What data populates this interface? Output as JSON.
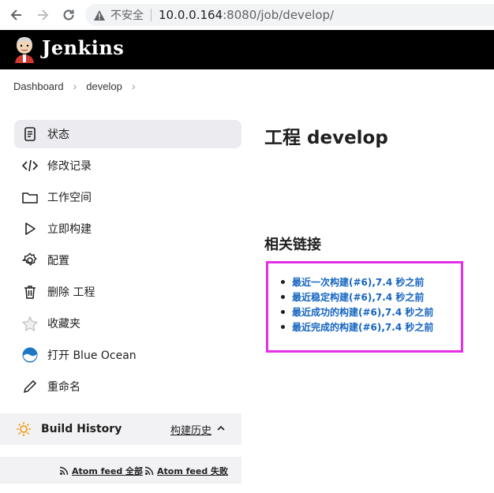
{
  "browser": {
    "insecure_label": "不安全",
    "url_host": "10.0.0.164",
    "url_path": ":8080/job/develop/"
  },
  "header": {
    "title": "Jenkins"
  },
  "breadcrumb": [
    "Dashboard",
    "develop"
  ],
  "sidebar": {
    "items": [
      {
        "label": "状态",
        "icon": "document-icon",
        "active": true
      },
      {
        "label": "修改记录",
        "icon": "code-icon"
      },
      {
        "label": "工作空间",
        "icon": "folder-icon"
      },
      {
        "label": "立即构建",
        "icon": "play-icon"
      },
      {
        "label": "配置",
        "icon": "gear-icon"
      },
      {
        "label": "删除 工程",
        "icon": "trash-icon"
      },
      {
        "label": "收藏夹",
        "icon": "star-icon"
      },
      {
        "label": "打开 Blue Ocean",
        "icon": "blue-ocean-icon"
      },
      {
        "label": "重命名",
        "icon": "pencil-icon"
      }
    ]
  },
  "build_history": {
    "title": "Build History",
    "link": "构建历史",
    "feeds": [
      "Atom feed 全部",
      "Atom feed 失败"
    ]
  },
  "main": {
    "title": "工程 develop",
    "section_title": "相关链接",
    "links": [
      "最近一次构建(#6),7.4 秒之前",
      "最近稳定构建(#6),7.4 秒之前",
      "最近成功的构建(#6),7.4 秒之前",
      "最近完成的构建(#6),7.4 秒之前"
    ]
  },
  "colors": {
    "link": "#1565c0",
    "highlight": "#e52ee5",
    "header_bg": "#000000"
  }
}
